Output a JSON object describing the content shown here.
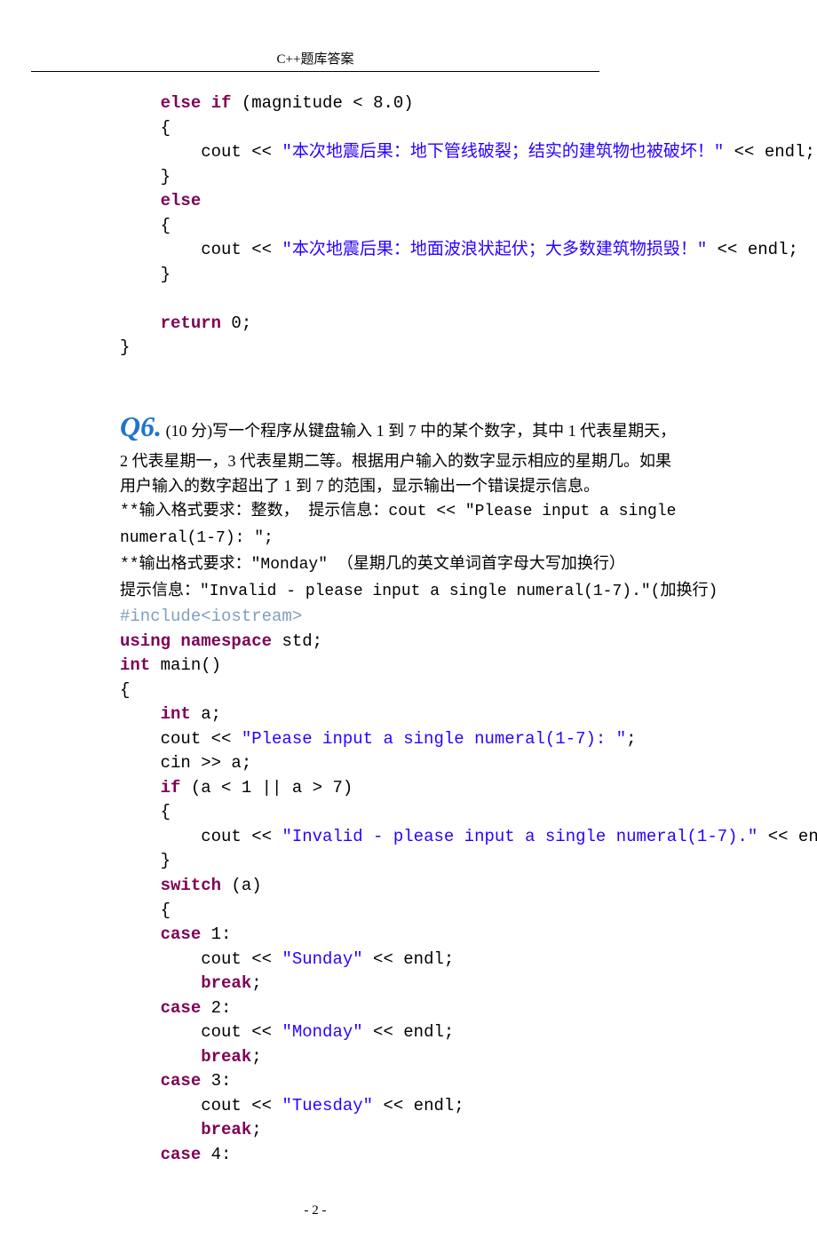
{
  "header": {
    "title": "C++题库答案"
  },
  "code1": {
    "kw_elseif": "else if",
    "cond": " (magnitude < 8.0)",
    "lbrace": "    {",
    "line_pre": "        cout << ",
    "str1": "\"本次地震后果：地下管线破裂；结实的建筑物也被破坏！\"",
    "line_post": " << endl;",
    "rbrace": "    }",
    "kw_else": "else",
    "lbrace2": "    {",
    "line2_pre": "        cout << ",
    "str2": "\"本次地震后果：地面波浪状起伏；大多数建筑物损毁！\"",
    "line2_post": " << endl;",
    "rbrace2": "    }",
    "blank": "",
    "ret_kw": "return",
    "ret_val": " 0;",
    "end": "}"
  },
  "q6": {
    "label": "Q6.",
    "desc_part1": " (10 分)写一个程序从键盘输入 1 到 7 中的某个数字，其中 1 代表星期天，",
    "desc_l2": "2 代表星期一，3 代表星期二等。根据用户输入的数字显示相应的星期几。如果",
    "desc_l3": "用户输入的数字超出了 1 到 7 的范围，显示输出一个错误提示信息。",
    "desc_l4a": "**输入格式要求：整数，  提示信息：cout << \"Please input a single",
    "desc_l4b": "numeral(1-7): \";",
    "desc_l5": "**输出格式要求：\"Monday\" （星期几的英文单词首字母大写加换行）",
    "desc_l6": "提示信息：\"Invalid - please input a single numeral(1-7).\"(加换行)"
  },
  "code2": {
    "inc": "#include<iostream>",
    "using_kw": "using",
    "ns_kw": "namespace",
    "std": " std;",
    "int_kw": "int",
    "main": " main()",
    "lbrace": "{",
    "intvar": "    int",
    "a_decl": " a;",
    "cout1_pre": "    cout << ",
    "str_prompt": "\"Please input a single numeral(1-7): \"",
    "cout1_post": ";",
    "cin": "    cin >> a;",
    "if_kw": "    if",
    "if_cond": " (a < 1 || a > 7)",
    "lb2": "    {",
    "invalid_pre": "        cout << ",
    "str_invalid": "\"Invalid - please input a single numeral(1-7).\"",
    "invalid_post": " << end",
    "rb2": "    }",
    "switch_kw": "    switch",
    "switch_expr": " (a)",
    "lb3": "    {",
    "case_kw": "case",
    "c1": " 1:",
    "c1_pre": "        cout << ",
    "c1_str": "\"Sunday\"",
    "c1_post": " << endl;",
    "break_kw": "break",
    "semi": ";",
    "c2": " 2:",
    "c2_str": "\"Monday\"",
    "c3": " 3:",
    "c3_str": "\"Tuesday\"",
    "c4": " 4:"
  },
  "footer": {
    "page": "- 2 -"
  }
}
